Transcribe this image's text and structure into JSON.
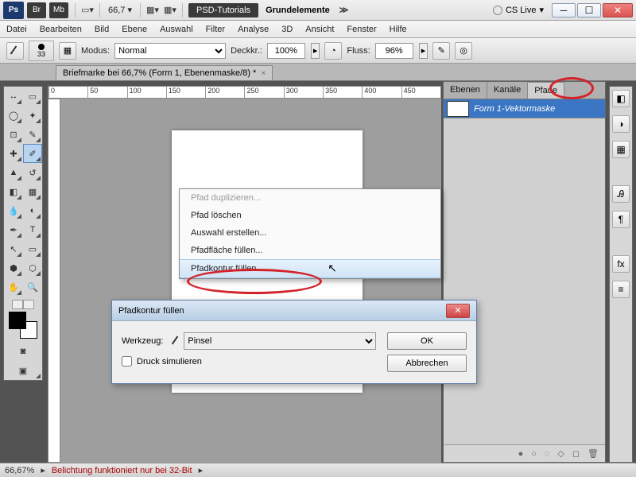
{
  "titlebar": {
    "app": "Ps",
    "buttons": {
      "br": "Br",
      "mb": "Mb"
    },
    "zoom": "66,7",
    "btn_dark": "PSD-Tutorials",
    "doc_title": "Grundelemente",
    "cslive": "CS Live"
  },
  "menu": [
    "Datei",
    "Bearbeiten",
    "Bild",
    "Ebene",
    "Auswahl",
    "Filter",
    "Analyse",
    "3D",
    "Ansicht",
    "Fenster",
    "Hilfe"
  ],
  "options": {
    "brush_size": "33",
    "modus_label": "Modus:",
    "modus_value": "Normal",
    "opacity_label": "Deckkr.:",
    "opacity_value": "100%",
    "flow_label": "Fluss:",
    "flow_value": "96%"
  },
  "tab": {
    "title": "Briefmarke bei 66,7% (Form 1, Ebenenmaske/8) *"
  },
  "ruler": [
    "0",
    "50",
    "100",
    "150",
    "200",
    "250",
    "300",
    "350",
    "400",
    "450"
  ],
  "panel": {
    "tabs": [
      "Ebenen",
      "Kanäle",
      "Pfade"
    ],
    "path_name": "Form 1-Vektormaske"
  },
  "context_menu": [
    {
      "label": "Pfad duplizieren...",
      "disabled": true
    },
    {
      "label": "Pfad löschen",
      "disabled": false
    },
    {
      "label": "Auswahl erstellen...",
      "disabled": false
    },
    {
      "label": "Pfadfläche füllen...",
      "disabled": false
    },
    {
      "label": "Pfadkontur füllen...",
      "disabled": false,
      "highlighted": true
    }
  ],
  "dialog": {
    "title": "Pfadkontur füllen",
    "tool_label": "Werkzeug:",
    "tool_value": "Pinsel",
    "simulate_label": "Druck simulieren",
    "ok": "OK",
    "cancel": "Abbrechen"
  },
  "status": {
    "zoom": "66,67%",
    "message": "Belichtung funktioniert nur bei 32-Bit"
  }
}
